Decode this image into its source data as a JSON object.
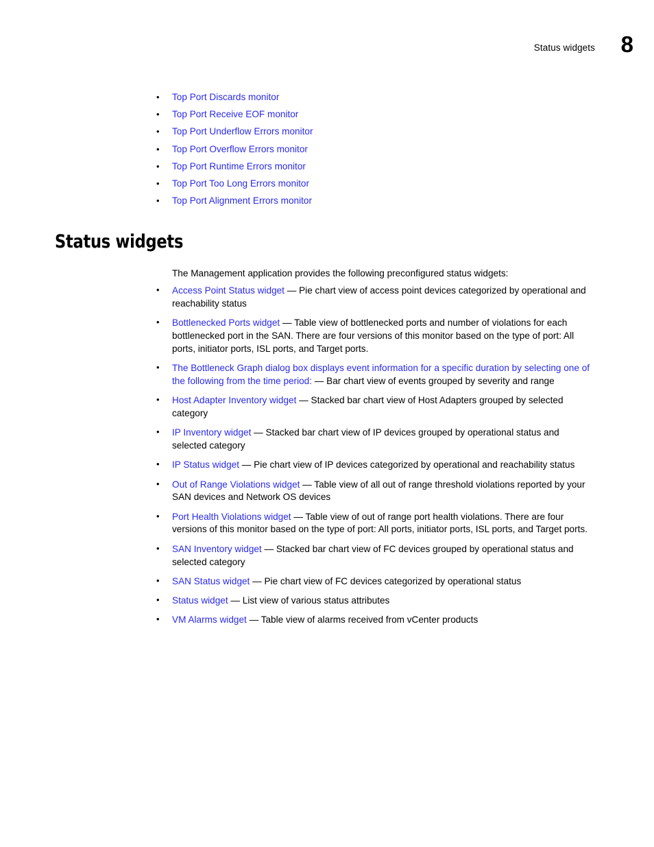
{
  "header": {
    "title": "Status widgets",
    "page_number": "8"
  },
  "colors": {
    "link": "#2a2aea",
    "text": "#000000",
    "background": "#ffffff"
  },
  "xref_list": {
    "bullet_glyph": "•",
    "items": [
      {
        "label": "Top Port Discards monitor"
      },
      {
        "label": "Top Port Receive EOF monitor"
      },
      {
        "label": "Top Port Underflow Errors monitor"
      },
      {
        "label": "Top Port Overflow Errors monitor"
      },
      {
        "label": "Top Port Runtime Errors monitor"
      },
      {
        "label": "Top Port Too Long Errors monitor"
      },
      {
        "label": "Top Port Alignment Errors monitor"
      }
    ]
  },
  "section": {
    "heading": "Status widgets",
    "intro": "The Management application provides the following preconfigured status widgets:"
  },
  "body_list": {
    "bullet_glyph": "•",
    "items": [
      {
        "link": "Access Point Status widget",
        "desc": " — Pie chart view of access point devices categorized by operational and reachability status"
      },
      {
        "link": "Bottlenecked Ports widget",
        "desc": " — Table view of bottlenecked ports and number of violations for each bottlenecked port in the SAN. There are four versions of this monitor based on the type of port: All ports, initiator ports, ISL ports, and Target ports."
      },
      {
        "link": "The Bottleneck Graph dialog box displays event information for a specific duration by selecting one of the following from the time period:",
        "desc": " — Bar chart view of events grouped by severity and range"
      },
      {
        "link": "Host Adapter Inventory widget",
        "desc": " — Stacked bar chart view of Host Adapters grouped by selected category"
      },
      {
        "link": "IP Inventory widget",
        "desc": " — Stacked bar chart view of IP devices grouped by operational status and selected category"
      },
      {
        "link": "IP Status widget",
        "desc": " — Pie chart view of IP devices categorized by operational and reachability status"
      },
      {
        "link": "Out of Range Violations widget",
        "desc": " — Table view of all out of range threshold violations reported by your SAN devices and Network OS devices"
      },
      {
        "link": "Port Health Violations widget",
        "desc": " — Table view of out of range port health violations. There are four versions of this monitor based on the type of port: All ports, initiator ports, ISL ports, and Target ports."
      },
      {
        "link": "SAN Inventory widget",
        "desc": " — Stacked bar chart view of FC devices grouped by operational status and selected category"
      },
      {
        "link": "SAN Status widget",
        "desc": " — Pie chart view of FC devices categorized by operational status"
      },
      {
        "link": "Status widget",
        "desc": " — List view of various status attributes"
      },
      {
        "link": "VM Alarms widget",
        "desc": " — Table view of alarms received from vCenter products"
      }
    ]
  }
}
